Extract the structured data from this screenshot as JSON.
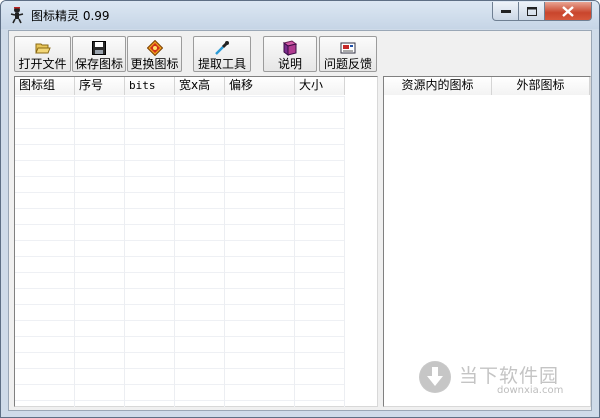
{
  "window": {
    "title": "图标精灵 0.99",
    "icon": "sprite-app-icon"
  },
  "window_controls": {
    "minimize": "minimize-icon",
    "maximize": "maximize-icon",
    "close": "close-icon"
  },
  "toolbar": {
    "buttons": [
      {
        "label": "打开文件",
        "icon": "open-folder-icon"
      },
      {
        "label": "保存图标",
        "icon": "save-disk-icon"
      },
      {
        "label": "更换图标",
        "icon": "replace-icon"
      },
      {
        "label": "提取工具",
        "icon": "eyedropper-icon"
      },
      {
        "label": "说明",
        "icon": "help-book-icon"
      },
      {
        "label": "问题反馈",
        "icon": "feedback-envelope-icon"
      }
    ]
  },
  "left_list": {
    "columns": [
      "图标组",
      "序号",
      "bits",
      "宽x高",
      "偏移",
      "大小"
    ]
  },
  "right_list": {
    "columns": [
      "资源内的图标",
      "外部图标"
    ]
  },
  "watermark": {
    "text": "当下软件园",
    "url": "downxia.com"
  },
  "colors": {
    "accent_close": "#c9452c",
    "window_frame": "#cfdbe9",
    "client_bg": "#f0f0f0"
  }
}
